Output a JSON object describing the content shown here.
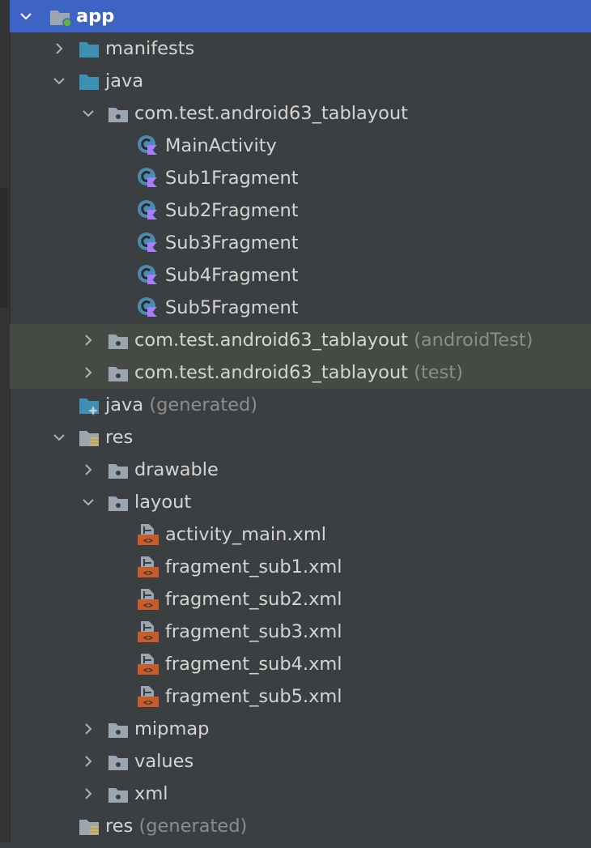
{
  "tree": {
    "rows": [
      {
        "label": "app",
        "suffix": "",
        "depth": 0,
        "arrow": "down",
        "icon": "module",
        "selected": true
      },
      {
        "label": "manifests",
        "suffix": "",
        "depth": 1,
        "arrow": "right",
        "icon": "folder-blue"
      },
      {
        "label": "java",
        "suffix": "",
        "depth": 1,
        "arrow": "down",
        "icon": "folder-blue"
      },
      {
        "label": "com.test.android63_tablayout",
        "suffix": "",
        "depth": 2,
        "arrow": "down",
        "icon": "package"
      },
      {
        "label": "MainActivity",
        "suffix": "",
        "depth": 3,
        "arrow": "none",
        "icon": "kotlin-class"
      },
      {
        "label": "Sub1Fragment",
        "suffix": "",
        "depth": 3,
        "arrow": "none",
        "icon": "kotlin-class"
      },
      {
        "label": "Sub2Fragment",
        "suffix": "",
        "depth": 3,
        "arrow": "none",
        "icon": "kotlin-class"
      },
      {
        "label": "Sub3Fragment",
        "suffix": "",
        "depth": 3,
        "arrow": "none",
        "icon": "kotlin-class"
      },
      {
        "label": "Sub4Fragment",
        "suffix": "",
        "depth": 3,
        "arrow": "none",
        "icon": "kotlin-class"
      },
      {
        "label": "Sub5Fragment",
        "suffix": "",
        "depth": 3,
        "arrow": "none",
        "icon": "kotlin-class"
      },
      {
        "label": "com.test.android63_tablayout",
        "suffix": "(androidTest)",
        "depth": 2,
        "arrow": "right",
        "icon": "package",
        "test": true
      },
      {
        "label": "com.test.android63_tablayout",
        "suffix": "(test)",
        "depth": 2,
        "arrow": "right",
        "icon": "package",
        "test": true
      },
      {
        "label": "java",
        "suffix": "(generated)",
        "depth": 1,
        "arrow": "none",
        "icon": "folder-generated"
      },
      {
        "label": "res",
        "suffix": "",
        "depth": 1,
        "arrow": "down",
        "icon": "folder-res"
      },
      {
        "label": "drawable",
        "suffix": "",
        "depth": 2,
        "arrow": "right",
        "icon": "package"
      },
      {
        "label": "layout",
        "suffix": "",
        "depth": 2,
        "arrow": "down",
        "icon": "package"
      },
      {
        "label": "activity_main.xml",
        "suffix": "",
        "depth": 3,
        "arrow": "none",
        "icon": "layout-xml"
      },
      {
        "label": "fragment_sub1.xml",
        "suffix": "",
        "depth": 3,
        "arrow": "none",
        "icon": "layout-xml"
      },
      {
        "label": "fragment_sub2.xml",
        "suffix": "",
        "depth": 3,
        "arrow": "none",
        "icon": "layout-xml"
      },
      {
        "label": "fragment_sub3.xml",
        "suffix": "",
        "depth": 3,
        "arrow": "none",
        "icon": "layout-xml"
      },
      {
        "label": "fragment_sub4.xml",
        "suffix": "",
        "depth": 3,
        "arrow": "none",
        "icon": "layout-xml"
      },
      {
        "label": "fragment_sub5.xml",
        "suffix": "",
        "depth": 3,
        "arrow": "none",
        "icon": "layout-xml"
      },
      {
        "label": "mipmap",
        "suffix": "",
        "depth": 2,
        "arrow": "right",
        "icon": "package"
      },
      {
        "label": "values",
        "suffix": "",
        "depth": 2,
        "arrow": "right",
        "icon": "package"
      },
      {
        "label": "xml",
        "suffix": "",
        "depth": 2,
        "arrow": "right",
        "icon": "package"
      },
      {
        "label": "res",
        "suffix": "(generated)",
        "depth": 1,
        "arrow": "none",
        "icon": "folder-res"
      }
    ]
  },
  "colors": {
    "background": "#3c3f41",
    "selection": "#3d63c5",
    "test_row": "#454b44",
    "text": "#d4d4d4",
    "suffix_text": "#8c8c8c",
    "folder_blue": "#3d8fb3",
    "folder_gray": "#9aa7b0",
    "kotlin_class": "#4a8cb0",
    "kotlin_badge": "#a97bff",
    "xml_orange": "#c75d2c"
  }
}
